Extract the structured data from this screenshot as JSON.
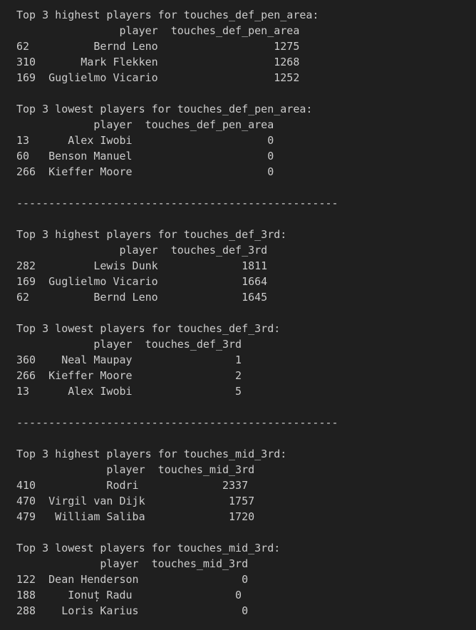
{
  "output_lines": [
    "Top 3 highest players for touches_def_pen_area:",
    "                player  touches_def_pen_area",
    "62          Bernd Leno                  1275",
    "310       Mark Flekken                  1268",
    "169  Guglielmo Vicario                  1252",
    "",
    "Top 3 lowest players for touches_def_pen_area:",
    "            player  touches_def_pen_area",
    "13      Alex Iwobi                     0",
    "60   Benson Manuel                     0",
    "266  Kieffer Moore                     0",
    "",
    "--------------------------------------------------",
    "",
    "Top 3 highest players for touches_def_3rd:",
    "                player  touches_def_3rd",
    "282         Lewis Dunk             1811",
    "169  Guglielmo Vicario             1664",
    "62          Bernd Leno             1645",
    "",
    "Top 3 lowest players for touches_def_3rd:",
    "            player  touches_def_3rd",
    "360    Neal Maupay                1",
    "266  Kieffer Moore                2",
    "13      Alex Iwobi                5",
    "",
    "--------------------------------------------------",
    "",
    "Top 3 highest players for touches_mid_3rd:",
    "              player  touches_mid_3rd",
    "410           Rodri             2337",
    "470  Virgil van Dijk             1757",
    "479   William Saliba             1720",
    "",
    "Top 3 lowest players for touches_mid_3rd:",
    "             player  touches_mid_3rd",
    "122  Dean Henderson                0",
    "188     Ionuț Radu                0",
    "288    Loris Karius                0"
  ]
}
